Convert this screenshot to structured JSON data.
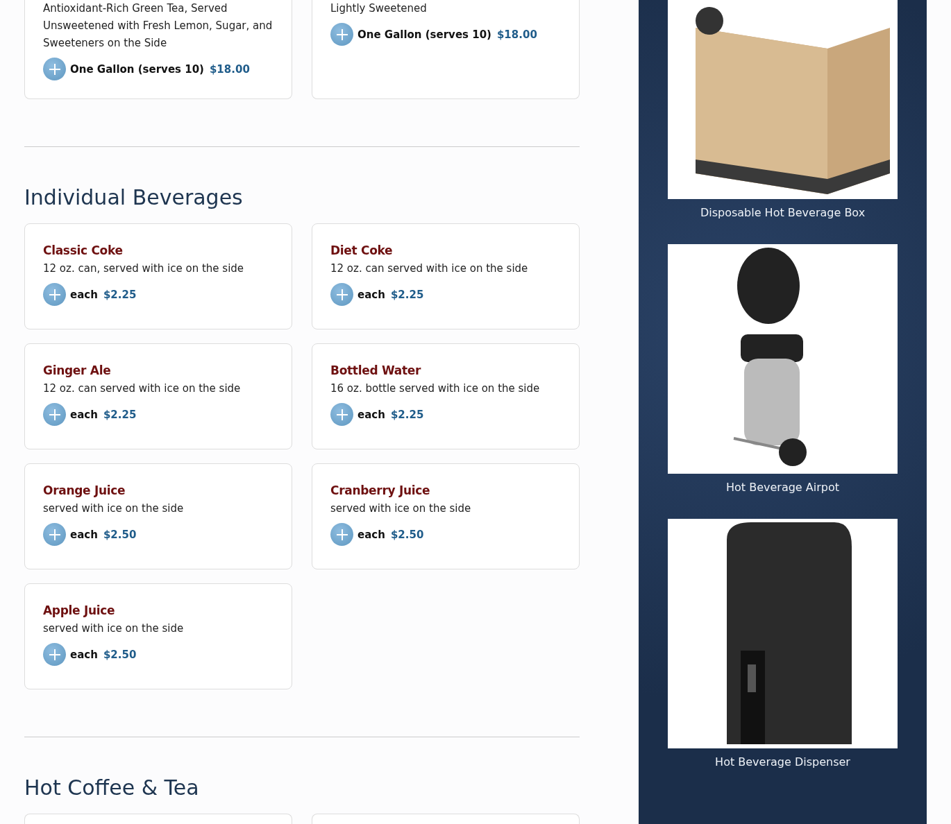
{
  "top_items": [
    {
      "description": "Antioxidant-Rich Green Tea, Served Unsweetened with Fresh Lemon, Sugar, and Sweeteners on the Side",
      "options": [
        {
          "label": "One Gallon (serves 10)",
          "price": "$18.00"
        }
      ]
    },
    {
      "description": "Lightly Sweetened",
      "options": [
        {
          "label": "One Gallon (serves 10)",
          "price": "$18.00"
        }
      ]
    }
  ],
  "sections": [
    {
      "title": "Individual Beverages",
      "items": [
        {
          "name": "Classic Coke",
          "description": "12 oz. can, served with ice on the side",
          "options": [
            {
              "label": "each",
              "price": "$2.25"
            }
          ]
        },
        {
          "name": "Diet Coke",
          "description": "12 oz. can served with ice on the side",
          "options": [
            {
              "label": "each",
              "price": "$2.25"
            }
          ]
        },
        {
          "name": "Ginger Ale",
          "description": "12 oz. can served with ice on the side",
          "options": [
            {
              "label": "each",
              "price": "$2.25"
            }
          ]
        },
        {
          "name": "Bottled Water",
          "description": "16 oz. bottle served with ice on the side",
          "options": [
            {
              "label": "each",
              "price": "$2.25"
            }
          ]
        },
        {
          "name": "Orange Juice",
          "description": "served with ice on the side",
          "options": [
            {
              "label": "each",
              "price": "$2.50"
            }
          ]
        },
        {
          "name": "Cranberry Juice",
          "description": "served with ice on the side",
          "options": [
            {
              "label": "each",
              "price": "$2.50"
            }
          ]
        },
        {
          "name": "Apple Juice",
          "description": "served with ice on the side",
          "options": [
            {
              "label": "each",
              "price": "$2.50"
            }
          ]
        }
      ]
    },
    {
      "title": "Hot Coffee & Tea",
      "items": [
        {
          "kind": "cut"
        },
        {
          "kind": "cut"
        }
      ]
    }
  ],
  "equipment": [
    {
      "kind": "box",
      "caption": "Disposable Hot Beverage Box"
    },
    {
      "kind": "airpot",
      "caption": "Hot Beverage Airpot"
    },
    {
      "kind": "dispenser",
      "caption": "Hot Beverage Dispenser"
    }
  ]
}
